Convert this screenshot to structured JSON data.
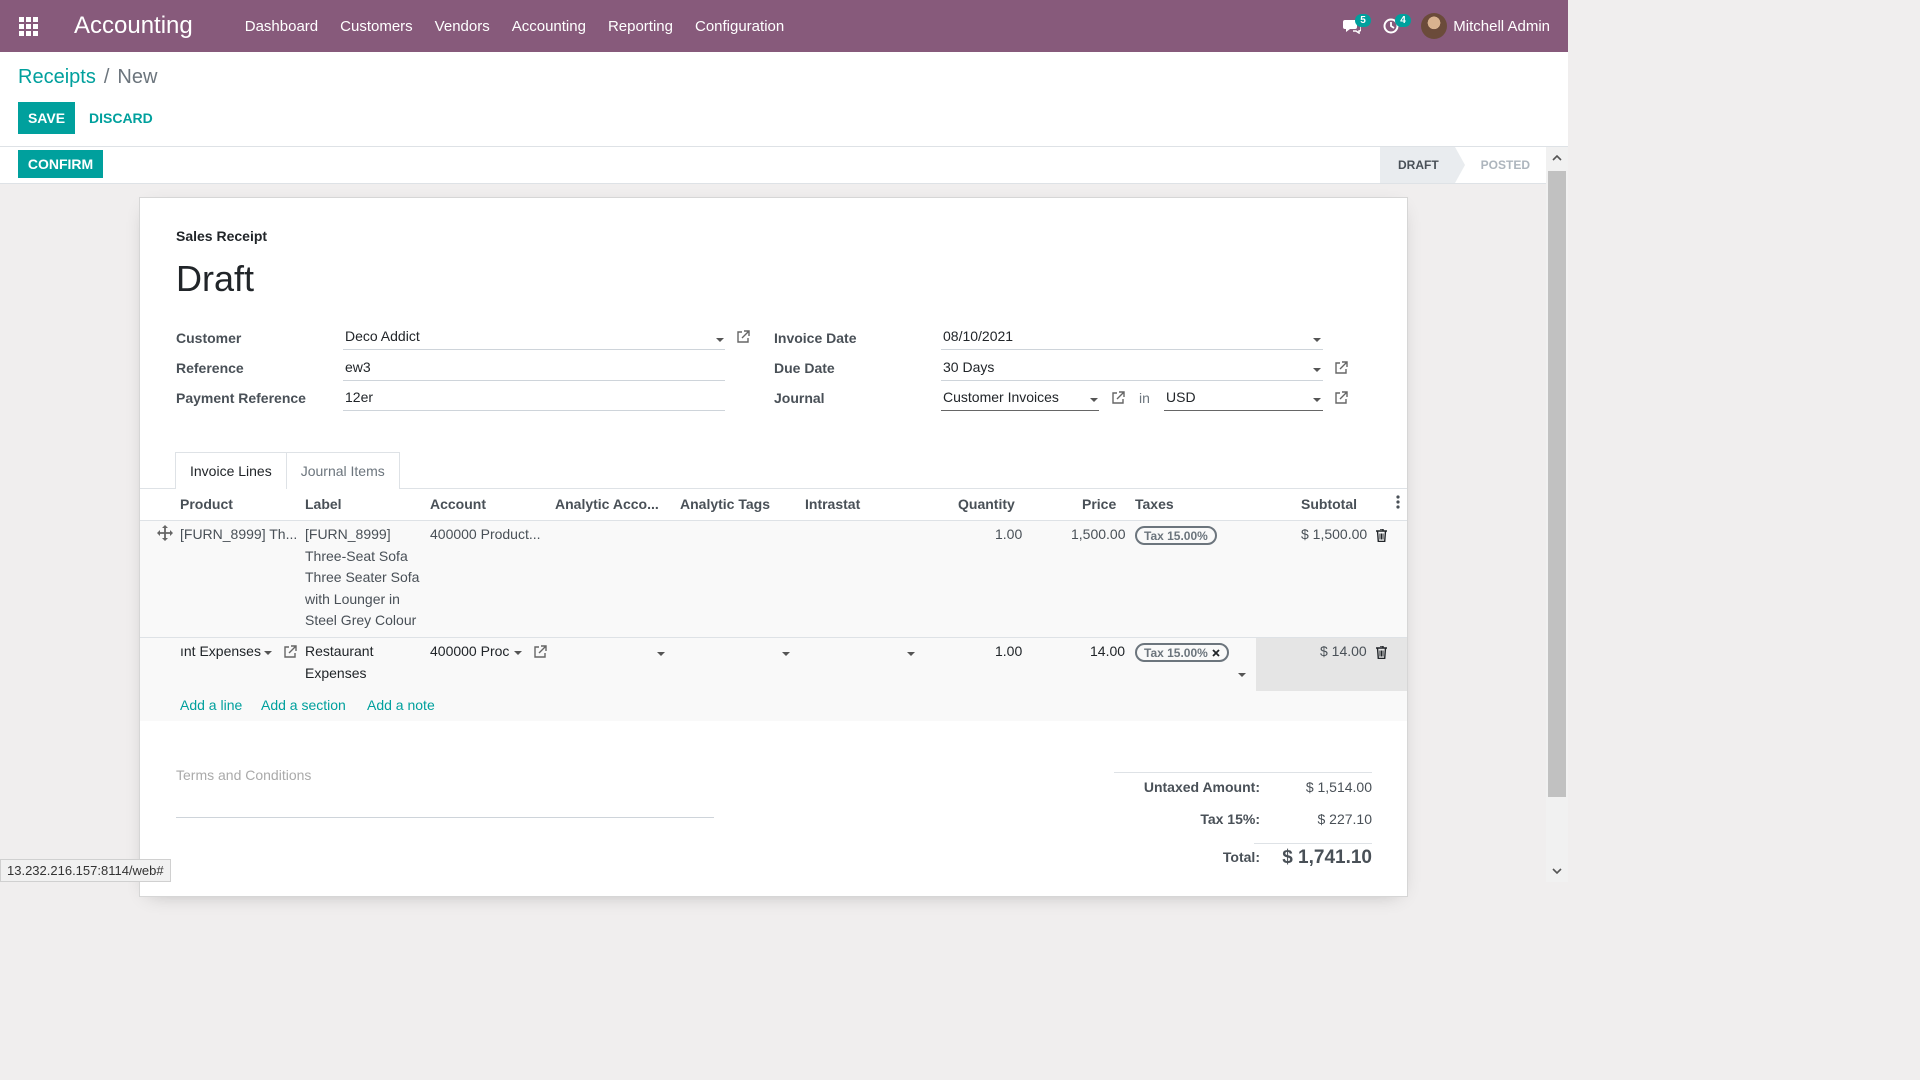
{
  "navbar": {
    "brand": "Accounting",
    "menu": [
      "Dashboard",
      "Customers",
      "Vendors",
      "Accounting",
      "Reporting",
      "Configuration"
    ],
    "messages_count": "5",
    "activities_count": "4",
    "user_name": "Mitchell Admin",
    "color": "#875a7b"
  },
  "breadcrumb": {
    "parent": "Receipts",
    "separator": "/",
    "current": "New"
  },
  "buttons": {
    "save": "SAVE",
    "discard": "DISCARD",
    "confirm": "CONFIRM"
  },
  "status": {
    "steps": [
      "DRAFT",
      "POSTED"
    ],
    "active": "DRAFT"
  },
  "sheet": {
    "type_label": "Sales Receipt",
    "title": "Draft",
    "left_fields": [
      {
        "label": "Customer",
        "value": "Deco Addict"
      },
      {
        "label": "Reference",
        "value": "ew3"
      },
      {
        "label": "Payment Reference",
        "value": "12er"
      }
    ],
    "right_fields": {
      "invoice_date_label": "Invoice Date",
      "invoice_date": "08/10/2021",
      "due_date_label": "Due Date",
      "due_date": "30 Days",
      "journal_label": "Journal",
      "journal": "Customer Invoices",
      "in_text": "in",
      "currency": "USD"
    }
  },
  "tabs": [
    "Invoice Lines",
    "Journal Items"
  ],
  "table": {
    "headers": [
      "Product",
      "Label",
      "Account",
      "Analytic Acco...",
      "Analytic Tags",
      "Intrastat",
      "Quantity",
      "Price",
      "Taxes",
      "Subtotal"
    ],
    "rows": [
      {
        "product": "[FURN_8999] Th...",
        "label_lines": [
          "[FURN_8999]",
          "Three-Seat Sofa",
          "Three Seater Sofa",
          "with Lounger in",
          "Steel Grey Colour"
        ],
        "account": "400000 Product...",
        "quantity": "1.00",
        "price": "1,500.00",
        "tax": "Tax 15.00%",
        "subtotal": "$ 1,500.00"
      },
      {
        "product": "ınt Expenses",
        "label_lines": [
          "Restaurant",
          "Expenses"
        ],
        "account": "400000 Proc",
        "quantity": "1.00",
        "price": "14.00",
        "tax": "Tax 15.00%",
        "subtotal": "$ 14.00"
      }
    ],
    "add_links": [
      "Add a line",
      "Add a section",
      "Add a note"
    ]
  },
  "terms_placeholder": "Terms and Conditions",
  "totals": {
    "untaxed_label": "Untaxed Amount:",
    "untaxed_value": "$ 1,514.00",
    "tax_label": "Tax 15%:",
    "tax_value": "$ 227.10",
    "total_label": "Total:",
    "total_value": "$ 1,741.10"
  },
  "url_hint": "13.232.216.157:8114/web#",
  "colors": {
    "accent": "#00a09d",
    "brand": "#875a7b"
  }
}
